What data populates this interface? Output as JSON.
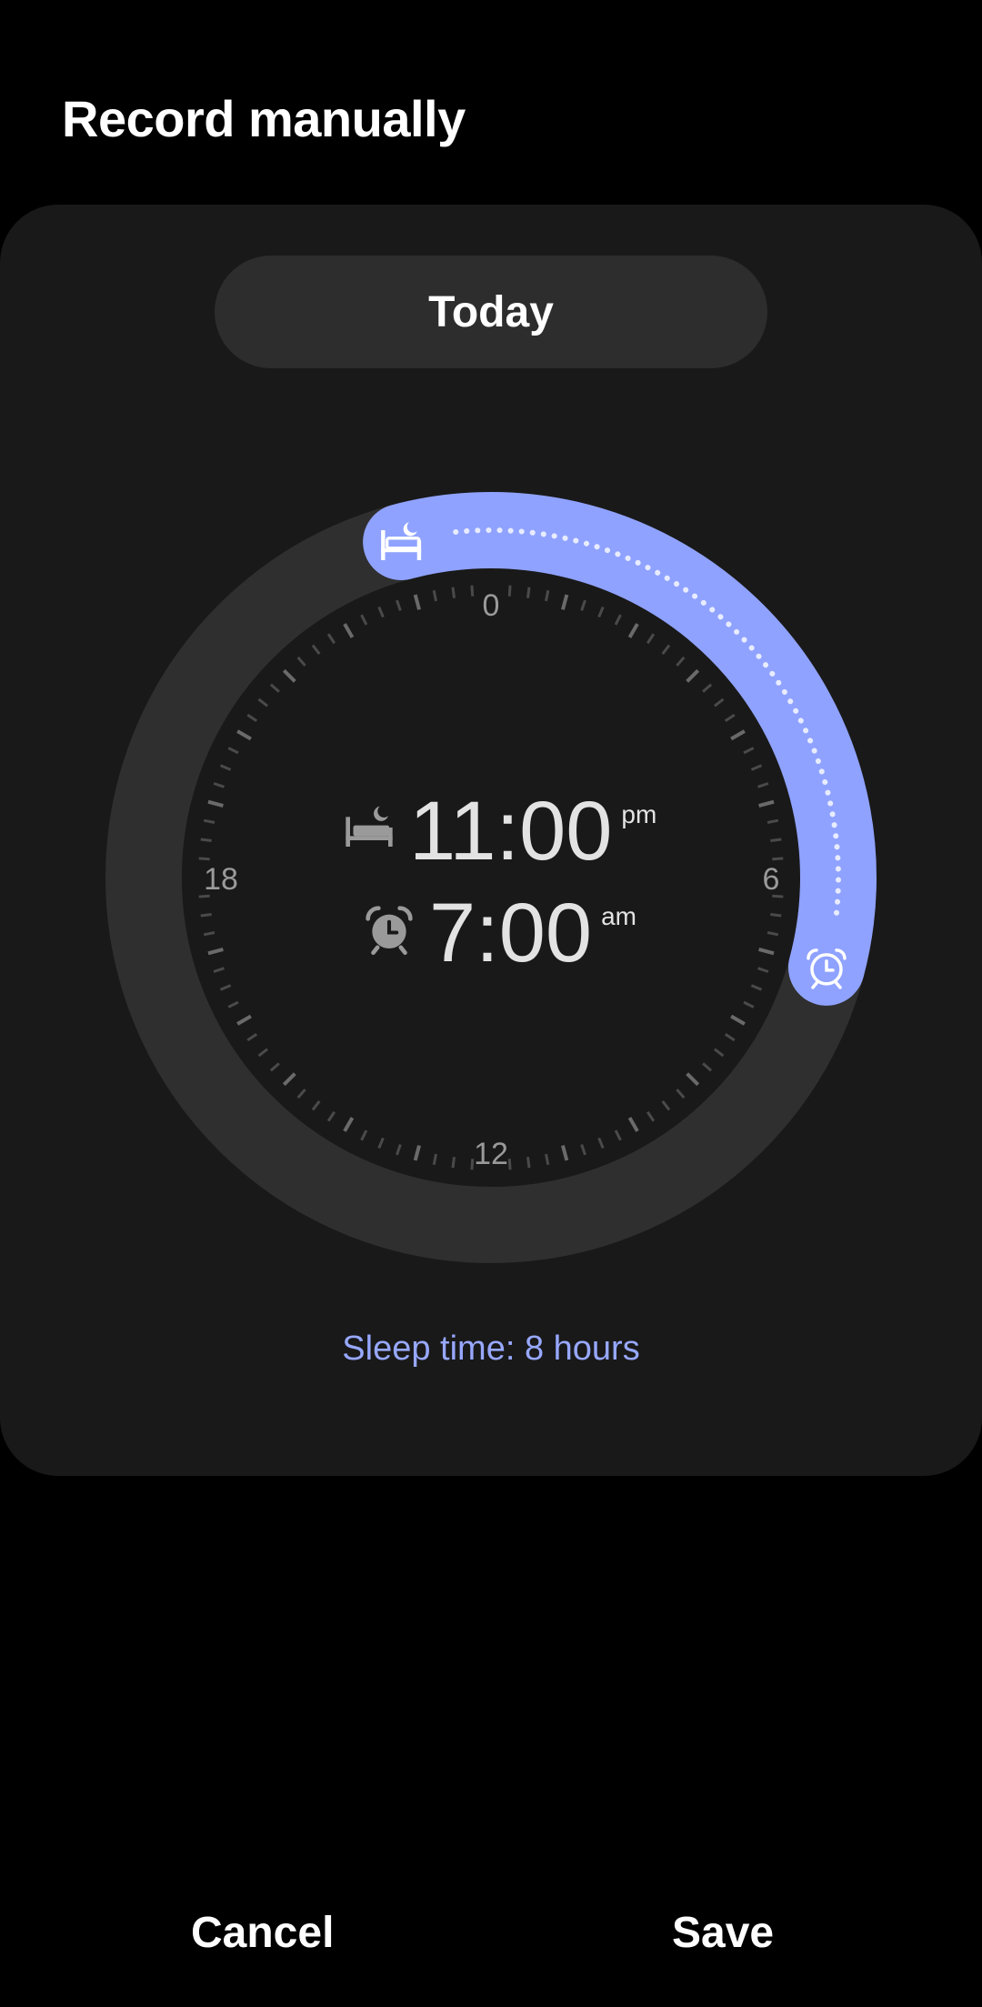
{
  "header": {
    "title": "Record manually"
  },
  "date_selector": {
    "label": "Today"
  },
  "dial": {
    "hour_labels": {
      "top": "0",
      "right": "6",
      "bottom": "12",
      "left": "18"
    },
    "bedtime_hour": 23,
    "wakeup_hour": 7,
    "accent_color": "#8fa2ff"
  },
  "times": {
    "bedtime": {
      "value": "11:00",
      "suffix": "pm",
      "icon": "bed-icon"
    },
    "wakeup": {
      "value": "7:00",
      "suffix": "am",
      "icon": "alarm-icon"
    }
  },
  "summary": {
    "sleep_time": "Sleep time: 8 hours"
  },
  "actions": {
    "cancel_label": "Cancel",
    "save_label": "Save"
  }
}
